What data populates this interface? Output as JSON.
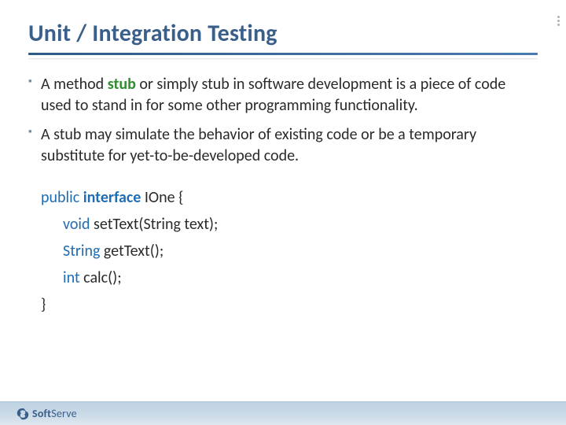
{
  "title": "Unit / Integration Testing",
  "bullets": [
    {
      "pre": "A method ",
      "kw": "stub",
      "post": " or simply stub in software development is a piece of code used to stand in for some other programming functionality."
    },
    {
      "text": "A stub may simulate the behavior of existing code or be a temporary substitute for yet-to-be-developed code."
    }
  ],
  "code": {
    "l1_kw1": "public",
    "l1_kw2": "interface",
    "l1_rest": " IOne {",
    "l2_kw": "void",
    "l2_rest": " setText(String text);",
    "l3_kw": "String",
    "l3_rest": " getText();",
    "l4_kw": "int",
    "l4_rest": " calc();",
    "l5": "}"
  },
  "footer": {
    "brand_bold": "Soft",
    "brand_rest": "Serve"
  }
}
